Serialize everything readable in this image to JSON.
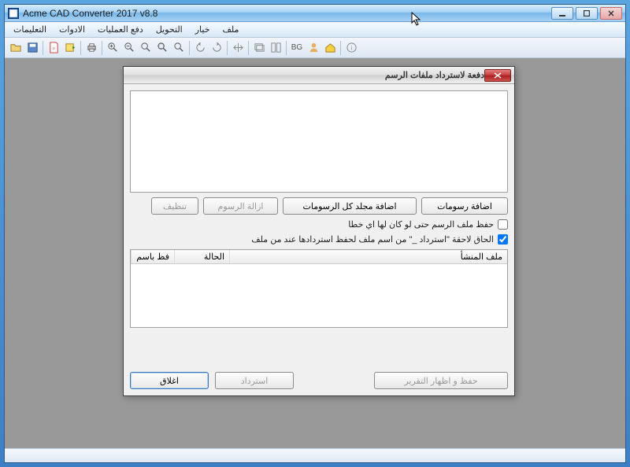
{
  "window": {
    "title": "Acme CAD Converter 2017 v8.8"
  },
  "menu": {
    "items": [
      "ملف",
      "خيار",
      "التحويل",
      "دفع العمليات",
      "الادوات",
      "التعليمات"
    ]
  },
  "toolbar": {
    "bg_label": "BG"
  },
  "dialog": {
    "title": "دفعة لاسترداد ملفات الرسم",
    "buttons": {
      "add_drawings": "اضافة رسومات",
      "add_folder": "اضافة مجلد كل الرسومات",
      "remove": "ازالة الرسوم",
      "clear": "تنظيف",
      "save_report": "حفظ و اظهار التقرير",
      "recover": "استرداد",
      "close": "اغلاق"
    },
    "checkboxes": {
      "save_even_error": "حفظ ملف الرسم حتى لو كان لها اي خطا",
      "append_suffix": "الحاق لاحقة \"استرداد _\" من اسم ملف لحفظ استردادها عند من ملف"
    },
    "table": {
      "col_source": "ملف المنشأ",
      "col_status": "الحالة",
      "col_savename": "فظ باسم"
    }
  }
}
